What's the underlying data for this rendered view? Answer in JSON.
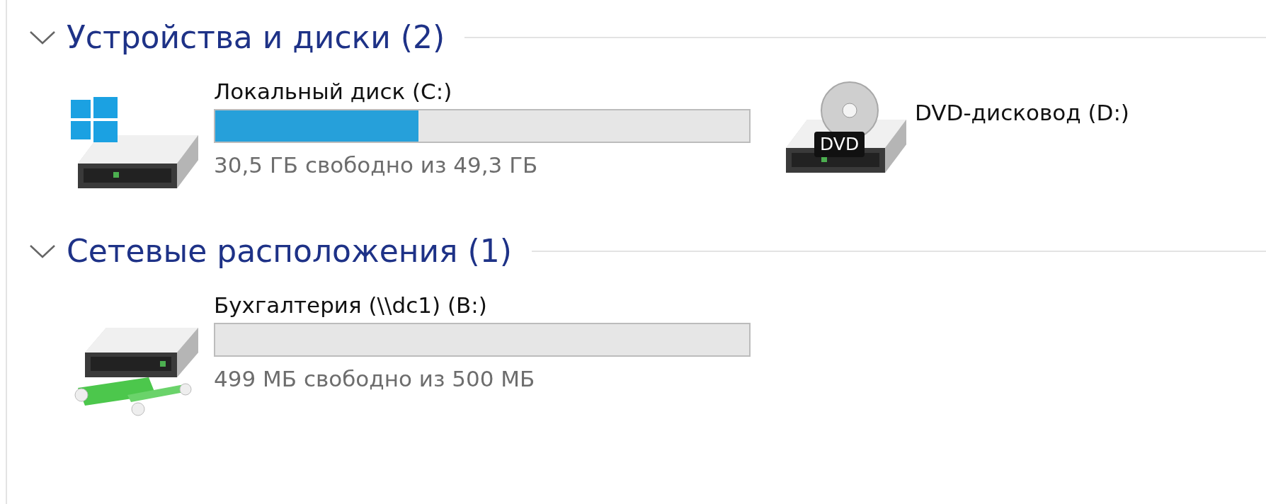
{
  "groups": [
    {
      "title": "Устройства и диски (2)",
      "expanded": true,
      "items": [
        {
          "kind": "system_drive",
          "name": "Локальный диск (C:)",
          "level": 0.38,
          "space": "30,5 ГБ свободно из 49,3 ГБ"
        },
        {
          "kind": "optical_drive",
          "badge": "DVD",
          "name": "DVD-дисковод (D:)"
        }
      ]
    },
    {
      "title": "Сетевые расположения (1)",
      "expanded": true,
      "items": [
        {
          "kind": "network_drive",
          "name": "Бухгалтерия (\\\\dc1) (B:)",
          "level": 0,
          "space": "499 МБ свободно из 500 МБ"
        }
      ]
    }
  ]
}
